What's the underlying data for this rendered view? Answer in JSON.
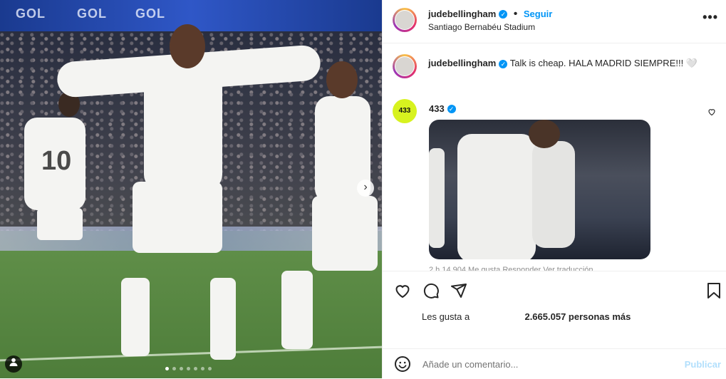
{
  "post": {
    "username": "judebellingham",
    "follow_label": "Seguir",
    "location": "Santiago Bernabéu Stadium",
    "more_label": "•••",
    "banner_text": [
      "GOL",
      "GOL",
      "GOL"
    ]
  },
  "caption": {
    "username": "judebellingham",
    "text": "Talk is cheap. HALA MADRID SIEMPRE!!! 🤍"
  },
  "comment": {
    "username": "433",
    "avatar_text": "433",
    "meta": "2 h   14.904 Me gusta   Responder   Ver traducción"
  },
  "likes": {
    "prefix": "Les gusta a",
    "suffix": "2.665.057 personas más"
  },
  "composer": {
    "placeholder": "Añade un comentario...",
    "publish_label": "Publicar"
  },
  "carousel": {
    "slides": 7,
    "active_index": 0
  },
  "colors": {
    "accent": "#0095f6",
    "publish_disabled": "#b2dffc",
    "muted": "#737373"
  },
  "icons": [
    "heart-icon",
    "comment-icon",
    "share-icon",
    "bookmark-icon",
    "emoji-icon",
    "verified-icon",
    "more-icon",
    "chevron-right-icon",
    "user-tag-icon"
  ]
}
